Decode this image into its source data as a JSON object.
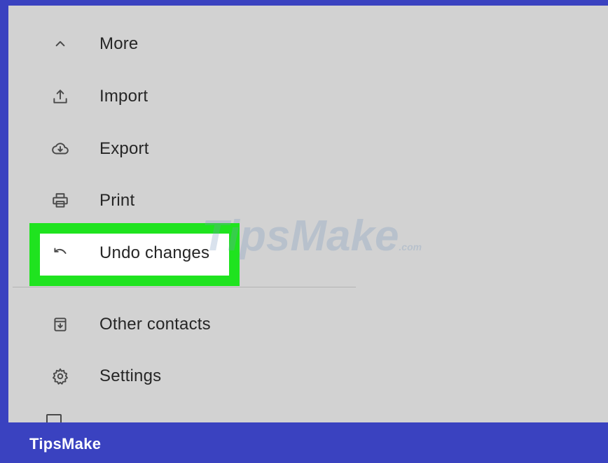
{
  "menu": {
    "items": [
      {
        "label": "More",
        "icon": "chevron-up-icon"
      },
      {
        "label": "Import",
        "icon": "upload-icon"
      },
      {
        "label": "Export",
        "icon": "cloud-download-icon"
      },
      {
        "label": "Print",
        "icon": "printer-icon"
      },
      {
        "label": "Undo changes",
        "icon": "undo-icon",
        "highlighted": true
      },
      {
        "label": "Other contacts",
        "icon": "archive-icon"
      },
      {
        "label": "Settings",
        "icon": "gear-icon"
      }
    ]
  },
  "watermark": {
    "text": "TipsMake",
    "suffix": ".com"
  },
  "footer": {
    "brand": "TipsMake"
  },
  "colors": {
    "frame": "#3a42c0",
    "panel": "#d2d2d2",
    "highlight_border": "#1fe31f"
  }
}
